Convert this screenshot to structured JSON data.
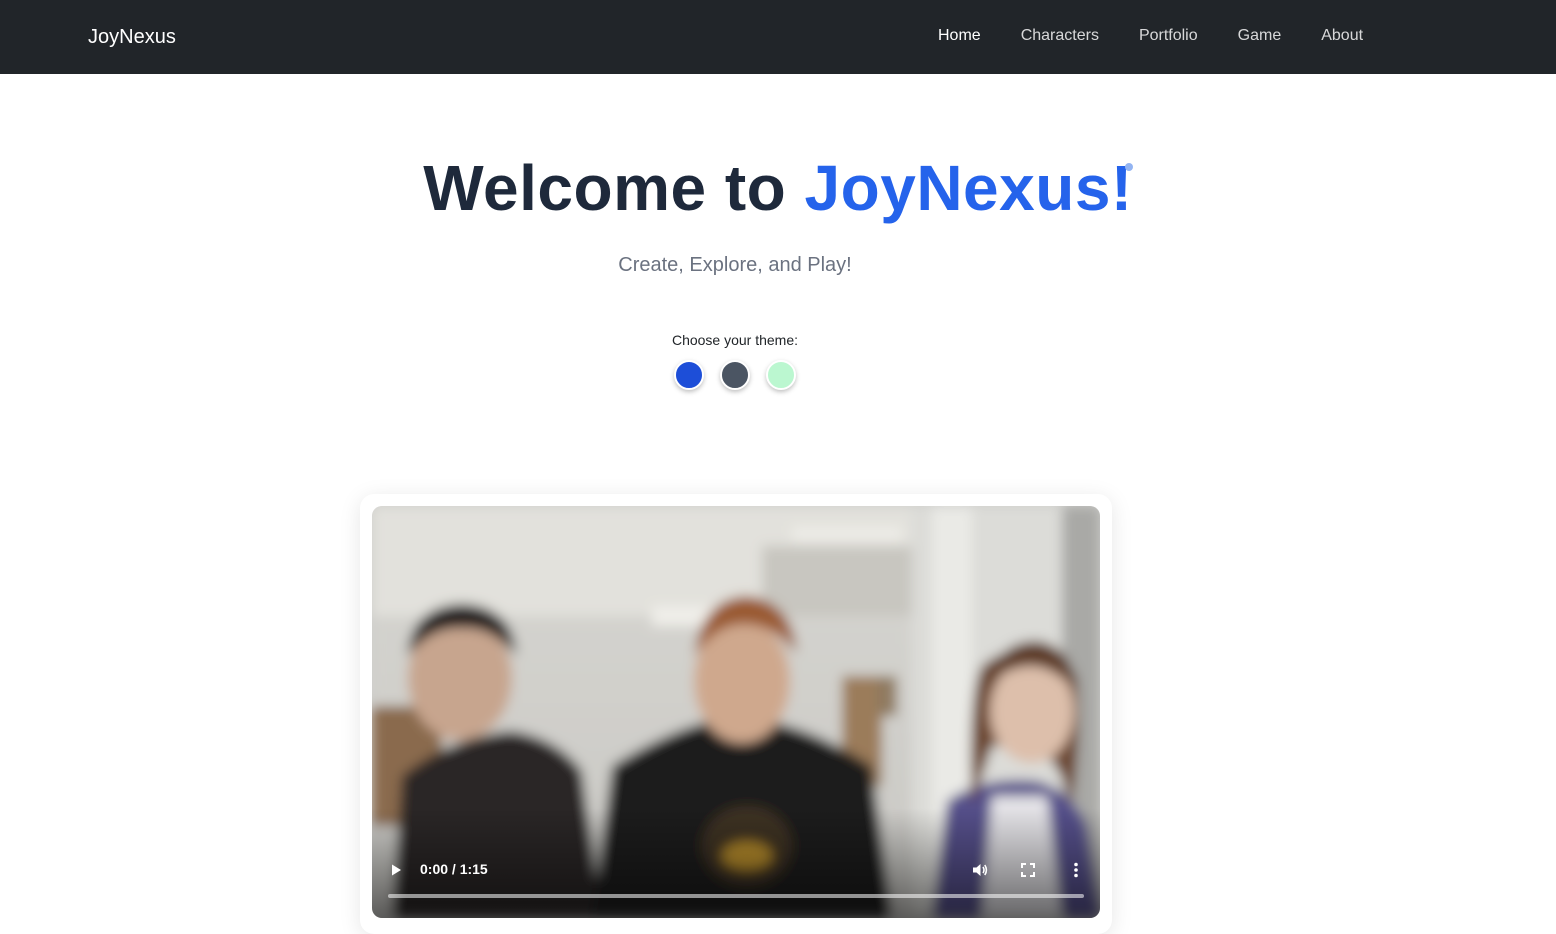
{
  "navbar": {
    "brand": "JoyNexus",
    "links": [
      {
        "label": "Home",
        "active": true
      },
      {
        "label": "Characters",
        "active": false
      },
      {
        "label": "Portfolio",
        "active": false
      },
      {
        "label": "Game",
        "active": false
      },
      {
        "label": "About",
        "active": false
      }
    ],
    "background_color": "#212529"
  },
  "hero": {
    "title_prefix": "Welcome to ",
    "title_brand": "JoyNexus!",
    "title_color": "#1e293b",
    "brand_color": "#2563eb",
    "subtitle": "Create, Explore, and Play!"
  },
  "theme_picker": {
    "label": "Choose your theme:",
    "swatches": [
      {
        "name": "blue",
        "color": "#1d4ed8"
      },
      {
        "name": "gray",
        "color": "#4b5563"
      },
      {
        "name": "green",
        "color": "#bbf7d0"
      }
    ]
  },
  "video": {
    "current_time": "0:00",
    "duration": "1:15",
    "time_display": "0:00 / 1:15",
    "progress_fraction": 0,
    "icons": {
      "play": "play-icon",
      "volume": "volume-icon",
      "fullscreen": "fullscreen-icon",
      "more": "more-options-icon"
    }
  }
}
